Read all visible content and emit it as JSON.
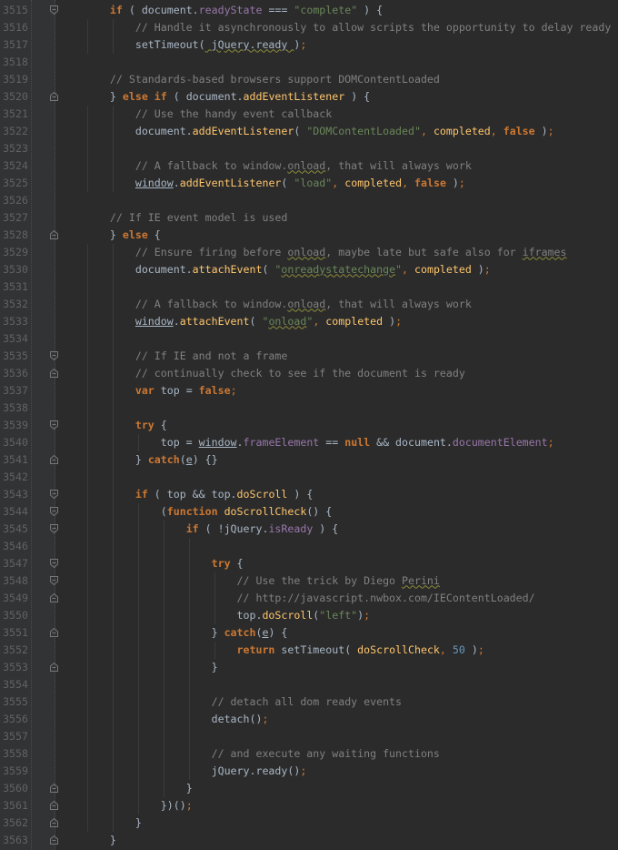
{
  "editor": {
    "theme_colors": {
      "background": "#2b2b2b",
      "gutter": "#313335",
      "keyword": "#cc7832",
      "text": "#a9b7c6",
      "comment": "#808080",
      "string": "#6a8759",
      "property": "#9876aa",
      "function": "#ffc66d",
      "number": "#6897bb"
    },
    "lines": [
      {
        "n": "3515",
        "indent": 4,
        "fold": "fold-start",
        "tokens": [
          [
            "kw",
            "if"
          ],
          [
            "pl",
            " ( document."
          ],
          [
            "prop",
            "readyState"
          ],
          [
            "pl",
            " === "
          ],
          [
            "str",
            "\"complete\""
          ],
          [
            "pl",
            " ) {"
          ]
        ]
      },
      {
        "n": "3516",
        "indent": 8,
        "fold": "",
        "tokens": [
          [
            "cm",
            "// Handle it asynchronously to allow scripts the opportunity to delay ready"
          ]
        ]
      },
      {
        "n": "3517",
        "indent": 8,
        "fold": "",
        "tokens": [
          [
            "pl",
            "setTimeout("
          ],
          [
            "typo pl",
            " jQuery.ready "
          ],
          [
            "pl",
            ")"
          ],
          [
            "punc",
            ";"
          ]
        ]
      },
      {
        "n": "3518",
        "indent": 0,
        "fold": "",
        "tokens": []
      },
      {
        "n": "3519",
        "indent": 4,
        "fold": "",
        "tokens": [
          [
            "cm",
            "// Standards-based browsers support DOMContentLoaded"
          ]
        ]
      },
      {
        "n": "3520",
        "indent": 4,
        "fold": "fold-end",
        "tokens": [
          [
            "pl",
            "} "
          ],
          [
            "kw",
            "else if"
          ],
          [
            "pl",
            " ( document."
          ],
          [
            "fn",
            "addEventListener"
          ],
          [
            "pl",
            " ) {"
          ]
        ]
      },
      {
        "n": "3521",
        "indent": 8,
        "fold": "",
        "tokens": [
          [
            "cm",
            "// Use the handy event callback"
          ]
        ]
      },
      {
        "n": "3522",
        "indent": 8,
        "fold": "",
        "tokens": [
          [
            "pl",
            "document."
          ],
          [
            "fn",
            "addEventListener"
          ],
          [
            "pl",
            "( "
          ],
          [
            "str",
            "\"DOMContentLoaded\""
          ],
          [
            "punc",
            ", "
          ],
          [
            "fn",
            "completed"
          ],
          [
            "punc",
            ", "
          ],
          [
            "kw",
            "false"
          ],
          [
            "pl",
            " )"
          ],
          [
            "punc",
            ";"
          ]
        ]
      },
      {
        "n": "3523",
        "indent": 0,
        "fold": "",
        "tokens": []
      },
      {
        "n": "3524",
        "indent": 8,
        "fold": "",
        "tokens": [
          [
            "cm",
            "// A fallback to window."
          ],
          [
            "typo cm",
            "onload"
          ],
          [
            "cm",
            ", that will always work"
          ]
        ]
      },
      {
        "n": "3525",
        "indent": 8,
        "fold": "",
        "tokens": [
          [
            "gl",
            "window"
          ],
          [
            "pl",
            "."
          ],
          [
            "fn",
            "addEventListener"
          ],
          [
            "pl",
            "( "
          ],
          [
            "str",
            "\"load\""
          ],
          [
            "punc",
            ", "
          ],
          [
            "fn",
            "completed"
          ],
          [
            "punc",
            ", "
          ],
          [
            "kw",
            "false"
          ],
          [
            "pl",
            " )"
          ],
          [
            "punc",
            ";"
          ]
        ]
      },
      {
        "n": "3526",
        "indent": 0,
        "fold": "",
        "tokens": []
      },
      {
        "n": "3527",
        "indent": 4,
        "fold": "",
        "tokens": [
          [
            "cm",
            "// If IE event model is used"
          ]
        ]
      },
      {
        "n": "3528",
        "indent": 4,
        "fold": "fold-end",
        "tokens": [
          [
            "pl",
            "} "
          ],
          [
            "kw",
            "else"
          ],
          [
            "pl",
            " {"
          ]
        ]
      },
      {
        "n": "3529",
        "indent": 8,
        "fold": "",
        "tokens": [
          [
            "cm",
            "// Ensure firing before "
          ],
          [
            "typo cm",
            "onload"
          ],
          [
            "cm",
            ", maybe late but safe also for "
          ],
          [
            "typo cm",
            "iframes"
          ]
        ]
      },
      {
        "n": "3530",
        "indent": 8,
        "fold": "",
        "tokens": [
          [
            "pl",
            "document."
          ],
          [
            "fn",
            "attachEvent"
          ],
          [
            "pl",
            "( "
          ],
          [
            "str",
            "\""
          ],
          [
            "typo str",
            "onreadystatechange"
          ],
          [
            "str",
            "\""
          ],
          [
            "punc",
            ", "
          ],
          [
            "fn",
            "completed"
          ],
          [
            "pl",
            " )"
          ],
          [
            "punc",
            ";"
          ]
        ]
      },
      {
        "n": "3531",
        "indent": 0,
        "fold": "",
        "tokens": []
      },
      {
        "n": "3532",
        "indent": 8,
        "fold": "",
        "tokens": [
          [
            "cm",
            "// A fallback to window."
          ],
          [
            "typo cm",
            "onload"
          ],
          [
            "cm",
            ", that will always work"
          ]
        ]
      },
      {
        "n": "3533",
        "indent": 8,
        "fold": "",
        "tokens": [
          [
            "gl",
            "window"
          ],
          [
            "pl",
            "."
          ],
          [
            "fn",
            "attachEvent"
          ],
          [
            "pl",
            "( "
          ],
          [
            "str",
            "\""
          ],
          [
            "typo str",
            "onload"
          ],
          [
            "str",
            "\""
          ],
          [
            "punc",
            ", "
          ],
          [
            "fn",
            "completed"
          ],
          [
            "pl",
            " )"
          ],
          [
            "punc",
            ";"
          ]
        ]
      },
      {
        "n": "3534",
        "indent": 0,
        "fold": "",
        "tokens": []
      },
      {
        "n": "3535",
        "indent": 8,
        "fold": "fold-start",
        "tokens": [
          [
            "cm",
            "// If IE and not a frame"
          ]
        ]
      },
      {
        "n": "3536",
        "indent": 8,
        "fold": "fold-end",
        "tokens": [
          [
            "cm",
            "// continually check to see if the document is ready"
          ]
        ]
      },
      {
        "n": "3537",
        "indent": 8,
        "fold": "",
        "tokens": [
          [
            "kw",
            "var"
          ],
          [
            "pl",
            " top = "
          ],
          [
            "kw",
            "false"
          ],
          [
            "punc",
            ";"
          ]
        ]
      },
      {
        "n": "3538",
        "indent": 0,
        "fold": "",
        "tokens": []
      },
      {
        "n": "3539",
        "indent": 8,
        "fold": "fold-start",
        "tokens": [
          [
            "kw",
            "try"
          ],
          [
            "pl",
            " {"
          ]
        ]
      },
      {
        "n": "3540",
        "indent": 12,
        "fold": "",
        "tokens": [
          [
            "pl",
            "top = "
          ],
          [
            "gl",
            "window"
          ],
          [
            "pl",
            "."
          ],
          [
            "prop",
            "frameElement"
          ],
          [
            "pl",
            " == "
          ],
          [
            "kw",
            "null"
          ],
          [
            "pl",
            " && document."
          ],
          [
            "prop",
            "documentElement"
          ],
          [
            "punc",
            ";"
          ]
        ]
      },
      {
        "n": "3541",
        "indent": 8,
        "fold": "fold-end",
        "tokens": [
          [
            "pl",
            "} "
          ],
          [
            "kw",
            "catch"
          ],
          [
            "pl",
            "("
          ],
          [
            "gl",
            "e"
          ],
          [
            "pl",
            ") {}"
          ]
        ]
      },
      {
        "n": "3542",
        "indent": 0,
        "fold": "",
        "tokens": []
      },
      {
        "n": "3543",
        "indent": 8,
        "fold": "fold-start",
        "tokens": [
          [
            "kw",
            "if"
          ],
          [
            "pl",
            " ( top && top."
          ],
          [
            "fn",
            "doScroll"
          ],
          [
            "pl",
            " ) {"
          ]
        ]
      },
      {
        "n": "3544",
        "indent": 12,
        "fold": "fold-start",
        "tokens": [
          [
            "pl",
            "("
          ],
          [
            "kw",
            "function"
          ],
          [
            "pl",
            " "
          ],
          [
            "fn",
            "doScrollCheck"
          ],
          [
            "pl",
            "() {"
          ]
        ]
      },
      {
        "n": "3545",
        "indent": 16,
        "fold": "fold-start",
        "tokens": [
          [
            "kw",
            "if"
          ],
          [
            "pl",
            " ( !jQuery."
          ],
          [
            "prop",
            "isReady"
          ],
          [
            "pl",
            " ) {"
          ]
        ]
      },
      {
        "n": "3546",
        "indent": 0,
        "fold": "",
        "tokens": []
      },
      {
        "n": "3547",
        "indent": 20,
        "fold": "fold-start",
        "tokens": [
          [
            "kw",
            "try"
          ],
          [
            "pl",
            " {"
          ]
        ]
      },
      {
        "n": "3548",
        "indent": 24,
        "fold": "fold-start",
        "tokens": [
          [
            "cm",
            "// Use the trick by Diego "
          ],
          [
            "typo cm",
            "Perini"
          ]
        ]
      },
      {
        "n": "3549",
        "indent": 24,
        "fold": "fold-end",
        "tokens": [
          [
            "cm",
            "// http://javascript.nwbox.com/IEContentLoaded/"
          ]
        ]
      },
      {
        "n": "3550",
        "indent": 24,
        "fold": "",
        "tokens": [
          [
            "pl",
            "top."
          ],
          [
            "fn",
            "doScroll"
          ],
          [
            "pl",
            "("
          ],
          [
            "str",
            "\"left\""
          ],
          [
            "pl",
            ")"
          ],
          [
            "punc",
            ";"
          ]
        ]
      },
      {
        "n": "3551",
        "indent": 20,
        "fold": "fold-end",
        "tokens": [
          [
            "pl",
            "} "
          ],
          [
            "kw",
            "catch"
          ],
          [
            "pl",
            "("
          ],
          [
            "gl",
            "e"
          ],
          [
            "pl",
            ") {"
          ]
        ]
      },
      {
        "n": "3552",
        "indent": 24,
        "fold": "",
        "tokens": [
          [
            "kw",
            "return"
          ],
          [
            "pl",
            " setTimeout( "
          ],
          [
            "fn",
            "doScrollCheck"
          ],
          [
            "punc",
            ", "
          ],
          [
            "num",
            "50"
          ],
          [
            "pl",
            " )"
          ],
          [
            "punc",
            ";"
          ]
        ]
      },
      {
        "n": "3553",
        "indent": 20,
        "fold": "fold-end",
        "tokens": [
          [
            "pl",
            "}"
          ]
        ]
      },
      {
        "n": "3554",
        "indent": 0,
        "fold": "",
        "tokens": []
      },
      {
        "n": "3555",
        "indent": 20,
        "fold": "",
        "tokens": [
          [
            "cm",
            "// detach all dom ready events"
          ]
        ]
      },
      {
        "n": "3556",
        "indent": 20,
        "fold": "",
        "tokens": [
          [
            "pl",
            "detach()"
          ],
          [
            "punc",
            ";"
          ]
        ]
      },
      {
        "n": "3557",
        "indent": 0,
        "fold": "",
        "tokens": []
      },
      {
        "n": "3558",
        "indent": 20,
        "fold": "",
        "tokens": [
          [
            "cm",
            "// and execute any waiting functions"
          ]
        ]
      },
      {
        "n": "3559",
        "indent": 20,
        "fold": "",
        "tokens": [
          [
            "pl",
            "jQuery.ready()"
          ],
          [
            "punc",
            ";"
          ]
        ]
      },
      {
        "n": "3560",
        "indent": 16,
        "fold": "fold-end",
        "tokens": [
          [
            "pl",
            "}"
          ]
        ]
      },
      {
        "n": "3561",
        "indent": 12,
        "fold": "fold-end",
        "tokens": [
          [
            "pl",
            "})()"
          ],
          [
            "punc",
            ";"
          ]
        ]
      },
      {
        "n": "3562",
        "indent": 8,
        "fold": "fold-end",
        "tokens": [
          [
            "pl",
            "}"
          ]
        ]
      },
      {
        "n": "3563",
        "indent": 4,
        "fold": "fold-end",
        "tokens": [
          [
            "pl",
            "}"
          ]
        ]
      }
    ]
  }
}
